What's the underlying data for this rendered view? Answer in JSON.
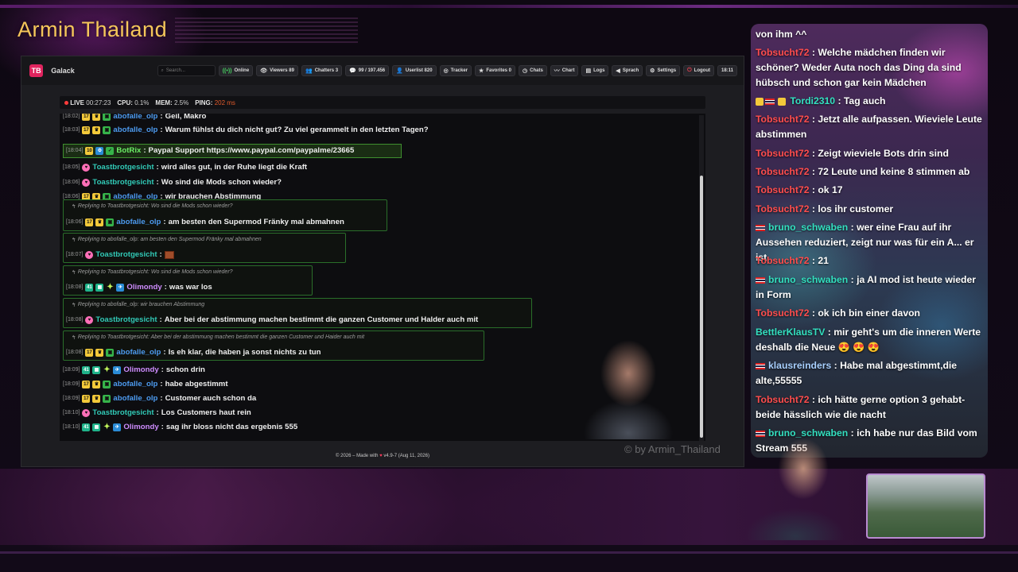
{
  "stream": {
    "title": "Armin Thailand",
    "watermark": "© by Armin_Thailand"
  },
  "app": {
    "logo": "TB",
    "name": "Galack",
    "search_placeholder": "Search...",
    "nav": [
      {
        "icon": "online-icon",
        "label": "Online"
      },
      {
        "icon": "eye-icon",
        "label": "Viewers 89"
      },
      {
        "icon": "users-icon",
        "label": "Chatters 3"
      },
      {
        "icon": "message-icon",
        "label": "99 / 197.456"
      },
      {
        "icon": "user-icon",
        "label": "Userlist 820"
      },
      {
        "icon": "target-icon",
        "label": "Tracker"
      },
      {
        "icon": "star-icon",
        "label": "Favorites 0"
      },
      {
        "icon": "clock-icon",
        "label": "Chats"
      },
      {
        "icon": "chart-icon",
        "label": "Chart"
      },
      {
        "icon": "logs-icon",
        "label": "Logs"
      },
      {
        "icon": "speech-icon",
        "label": "Sprach"
      },
      {
        "icon": "gear-icon",
        "label": "Settings"
      },
      {
        "icon": "logout-icon",
        "label": "Logout"
      },
      {
        "icon": "clock-text",
        "label": "18:11"
      }
    ],
    "status": {
      "live_label": "LIVE",
      "live_time": "00:27:23",
      "cpu_label": "CPU:",
      "cpu_value": "0.1%",
      "mem_label": "MEM:",
      "mem_value": "2.5%",
      "ping_label": "PING:",
      "ping_value": "202 ms"
    },
    "footer": {
      "left": "© 2026 – Made with",
      "right": "v4.9-7 (Aug 11, 2026)"
    }
  },
  "messages": [
    {
      "time": "[18:02]",
      "user": "abofalle_olp",
      "text": "Geil, Makro"
    },
    {
      "time": "[18:03]",
      "user": "abofalle_olp",
      "text": "Warum fühlst du dich nicht gut? Zu viel gerammelt in den letzten Tagen?"
    },
    {
      "time": "[18:04]",
      "badge": "10",
      "user": "BotRix",
      "text": "Paypal Support https://www.paypal.com/paypalme/23665"
    },
    {
      "time": "[18:05]",
      "user": "Toastbrotgesicht",
      "text": "wird alles gut, in der Ruhe liegt die Kraft"
    },
    {
      "time": "[18:06]",
      "user": "Toastbrotgesicht",
      "text": "Wo sind die Mods schon wieder?"
    },
    {
      "time": "[18:06]",
      "user": "abofalle_olp",
      "text": "wir brauchen Abstimmung"
    },
    {
      "reply": "Replying to Toastbrotgesicht: Wo sind die Mods schon wieder?",
      "time": "[18:06]",
      "user": "abofalle_olp",
      "text": "am besten den Supermod Fränky mal abmahnen"
    },
    {
      "reply": "Replying to abofalle_olp: am besten den Supermod Fränky mal abmahnen",
      "time": "[18:07]",
      "user": "Toastbrotgesicht",
      "text": ""
    },
    {
      "reply": "Replying to Toastbrotgesicht: Wo sind die Mods schon wieder?",
      "time": "[18:08]",
      "user": "Olimondy",
      "text": "was war los"
    },
    {
      "reply": "Replying to abofalle_olp: wir brauchen Abstimmung",
      "time": "[18:08]",
      "user": "Toastbrotgesicht",
      "text": "Aber bei der abstimmung machen bestimmt die ganzen Customer und Halder auch mit"
    },
    {
      "reply": "Replying to Toastbrotgesicht: Aber bei der abstimmung machen bestimmt die ganzen Customer und Haider auch mit",
      "time": "[18:08]",
      "user": "abofalle_olp",
      "text": "Is eh klar, die haben ja sonst nichts zu tun"
    },
    {
      "time": "[18:09]",
      "user": "Olimondy",
      "text": "schon drin"
    },
    {
      "time": "[18:09]",
      "user": "abofalle_olp",
      "text": "habe abgestimmt"
    },
    {
      "time": "[18:09]",
      "user": "abofalle_olp",
      "text": "Customer auch schon da"
    },
    {
      "time": "[18:10]",
      "user": "Toastbrotgesicht",
      "text": "Los Customers haut rein"
    },
    {
      "time": "[18:10]",
      "user": "Olimondy",
      "text": "sag ihr bloss nicht das ergebnis 555"
    }
  ],
  "overlay_chat": [
    {
      "user": "",
      "text": "von ihm ^^"
    },
    {
      "user": "Tobsucht72",
      "text": ": Welche mädchen finden wir schöner? Weder Auta noch das Ding da sind hübsch und schon gar kein Mädchen"
    },
    {
      "user": "Tordi2310",
      "text": ": Tag auch"
    },
    {
      "user": "Tobsucht72",
      "text": ": Jetzt alle aufpassen. Wieviele Leute abstimmen"
    },
    {
      "user": "Tobsucht72",
      "text": ": Zeigt wieviele Bots drin sind"
    },
    {
      "user": "Tobsucht72",
      "text": ": 72 Leute und keine 8 stimmen ab"
    },
    {
      "user": "Tobsucht72",
      "text": ": ok 17"
    },
    {
      "user": "Tobsucht72",
      "text": ": los ihr customer"
    },
    {
      "user": "bruno_schwaben",
      "text": ": wer eine Frau auf ihr Aussehen reduziert, zeigt nur was für ein A... er ist"
    },
    {
      "user": "Tobsucht72",
      "text": ": 21"
    },
    {
      "user": "bruno_schwaben",
      "text": ": ja AI mod ist heute wieder in Form"
    },
    {
      "user": "Tobsucht72",
      "text": ": ok ich bin einer davon"
    },
    {
      "user": "BettlerKlausTV",
      "text": ": mir geht's um die inneren Werte deshalb die Neue 😍 😍 😍"
    },
    {
      "user": "klausreinders",
      "text": ": Habe mal abgestimmt,die alte,55555"
    },
    {
      "user": "Tobsucht72",
      "text": ": ich hätte gerne option 3 gehabt- beide hässlich wie die nacht"
    },
    {
      "user": "bruno_schwaben",
      "text": ": ich habe nur das Bild vom Stream 555"
    }
  ]
}
